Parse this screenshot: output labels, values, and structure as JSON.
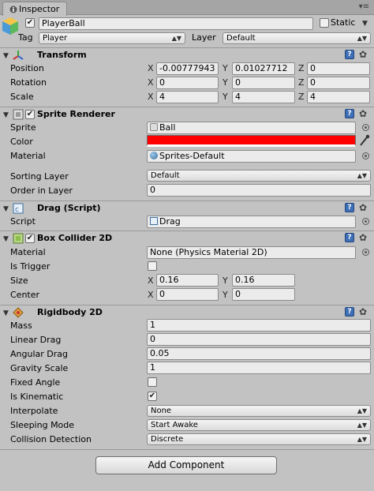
{
  "tab": {
    "label": "Inspector"
  },
  "gameobject": {
    "active": true,
    "name": "PlayerBall",
    "static_label": "Static",
    "static": false,
    "tag_label": "Tag",
    "tag_value": "Player",
    "layer_label": "Layer",
    "layer_value": "Default"
  },
  "transform": {
    "title": "Transform",
    "position_label": "Position",
    "rotation_label": "Rotation",
    "scale_label": "Scale",
    "axes": [
      "X",
      "Y",
      "Z"
    ],
    "position": [
      "-0.00777943",
      "0.01027712",
      "0"
    ],
    "rotation": [
      "0",
      "0",
      "0"
    ],
    "scale": [
      "4",
      "4",
      "4"
    ]
  },
  "sprite_renderer": {
    "title": "Sprite Renderer",
    "enabled": true,
    "sprite_label": "Sprite",
    "sprite_value": "Ball",
    "color_label": "Color",
    "color_value": "#ff0000",
    "material_label": "Material",
    "material_value": "Sprites-Default",
    "sorting_layer_label": "Sorting Layer",
    "sorting_layer_value": "Default",
    "order_label": "Order in Layer",
    "order_value": "0"
  },
  "drag_script": {
    "title": "Drag (Script)",
    "script_label": "Script",
    "script_value": "Drag"
  },
  "box_collider": {
    "title": "Box Collider 2D",
    "enabled": true,
    "material_label": "Material",
    "material_value": "None (Physics Material 2D)",
    "is_trigger_label": "Is Trigger",
    "is_trigger": false,
    "size_label": "Size",
    "size": [
      "0.16",
      "0.16"
    ],
    "center_label": "Center",
    "center": [
      "0",
      "0"
    ],
    "axes": [
      "X",
      "Y"
    ]
  },
  "rigidbody": {
    "title": "Rigidbody 2D",
    "mass_label": "Mass",
    "mass": "1",
    "linear_drag_label": "Linear Drag",
    "linear_drag": "0",
    "angular_drag_label": "Angular Drag",
    "angular_drag": "0.05",
    "gravity_label": "Gravity Scale",
    "gravity": "1",
    "fixed_angle_label": "Fixed Angle",
    "fixed_angle": false,
    "kinematic_label": "Is Kinematic",
    "kinematic": true,
    "interpolate_label": "Interpolate",
    "interpolate": "None",
    "sleeping_label": "Sleeping Mode",
    "sleeping": "Start Awake",
    "collision_label": "Collision Detection",
    "collision": "Discrete"
  },
  "add_component_label": "Add Component",
  "colors": {
    "panel_bg": "#c2c2c2",
    "help_icon": "#3f6fb6",
    "sprite_color": "#ff0000"
  }
}
